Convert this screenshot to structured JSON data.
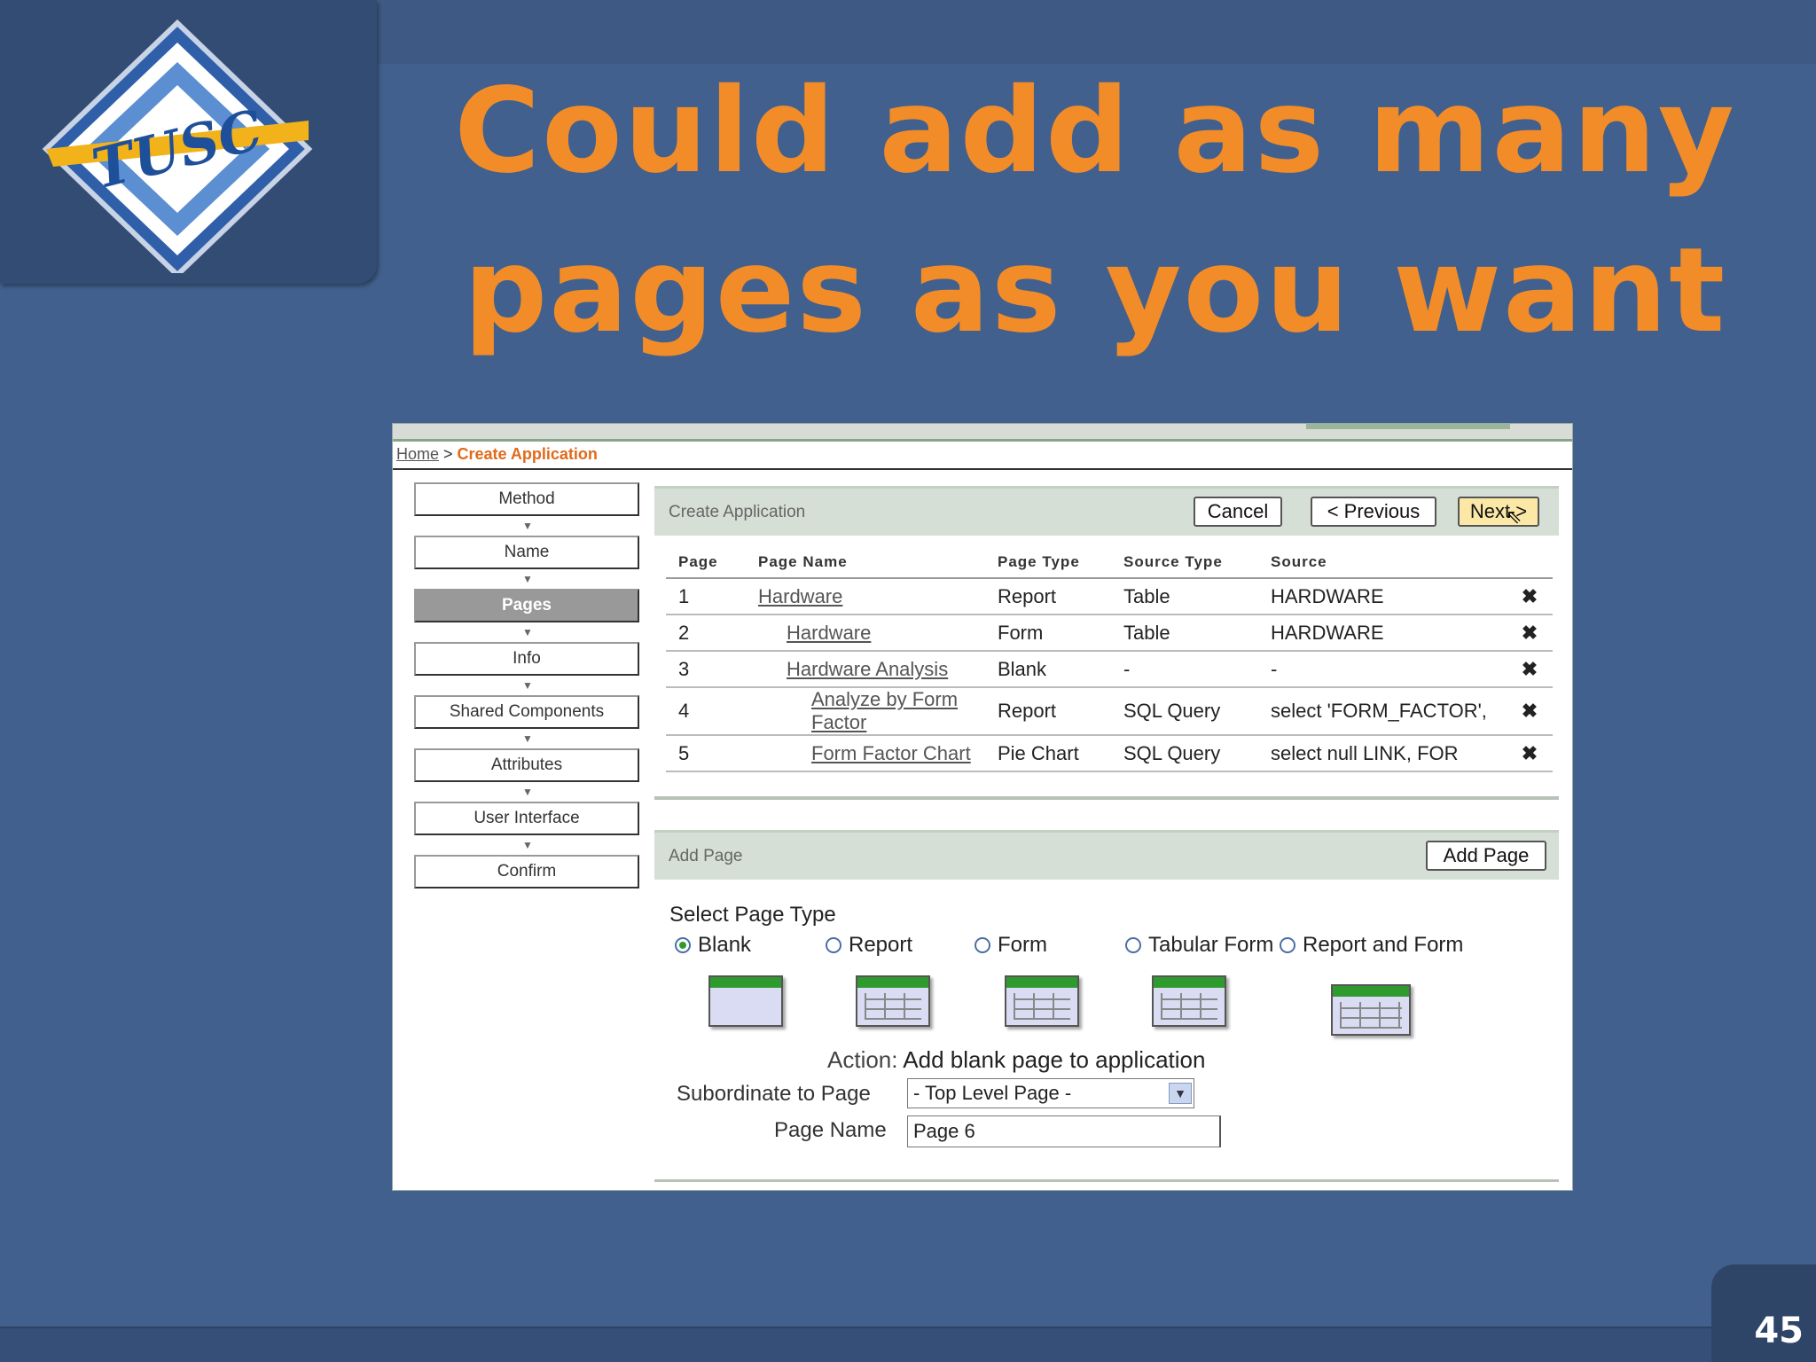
{
  "slide": {
    "title_line1": "Could add as many",
    "title_line2": "pages as you want",
    "logo_text": "TUSC",
    "page_number": "45"
  },
  "app": {
    "breadcrumb": {
      "home": "Home",
      "separator": " > ",
      "current": "Create Application"
    },
    "steps": [
      {
        "label": "Method",
        "active": false
      },
      {
        "label": "Name",
        "active": false
      },
      {
        "label": "Pages",
        "active": true
      },
      {
        "label": "Info",
        "active": false
      },
      {
        "label": "Shared Components",
        "active": false
      },
      {
        "label": "Attributes",
        "active": false
      },
      {
        "label": "User Interface",
        "active": false
      },
      {
        "label": "Confirm",
        "active": false
      }
    ],
    "create_region": {
      "title": "Create Application",
      "cancel_label": "Cancel",
      "previous_label": "< Previous",
      "next_label": "Next >"
    },
    "pages_table": {
      "columns": [
        "Page",
        "Page Name",
        "Page Type",
        "Source Type",
        "Source",
        ""
      ],
      "rows": [
        {
          "page": "1",
          "name": "Hardware",
          "type": "Report",
          "source_type": "Table",
          "source": "HARDWARE",
          "delete": "✖"
        },
        {
          "page": "2",
          "name": "Hardware",
          "type": "Form",
          "source_type": "Table",
          "source": "HARDWARE",
          "delete": "✖"
        },
        {
          "page": "3",
          "name": "Hardware Analysis",
          "type": "Blank",
          "source_type": "-",
          "source": "-",
          "delete": "✖"
        },
        {
          "page": "4",
          "name": "Analyze by Form Factor",
          "type": "Report",
          "source_type": "SQL Query",
          "source": "select 'FORM_FACTOR',",
          "delete": "✖"
        },
        {
          "page": "5",
          "name": "Form Factor Chart",
          "type": "Pie Chart",
          "source_type": "SQL Query",
          "source": "select null LINK, FOR",
          "delete": "✖"
        }
      ]
    },
    "add_region": {
      "title": "Add Page",
      "add_button": "Add Page",
      "select_type_label": "Select Page Type",
      "types": [
        "Blank",
        "Report",
        "Form",
        "Tabular Form",
        "Report and Form"
      ],
      "selected_type": "Blank",
      "action_prefix": "Action:",
      "action_text": "Add blank page to application",
      "parent_label": "Subordinate to Page",
      "parent_value": "- Top Level Page -",
      "name_label": "Page Name",
      "name_value": "Page 6"
    }
  },
  "colors": {
    "slide_bg": "#42608d",
    "title": "#f28c28",
    "region_bg": "#d5dfd5",
    "delete": "#d0142c",
    "accent_orange": "#e06a1b"
  }
}
